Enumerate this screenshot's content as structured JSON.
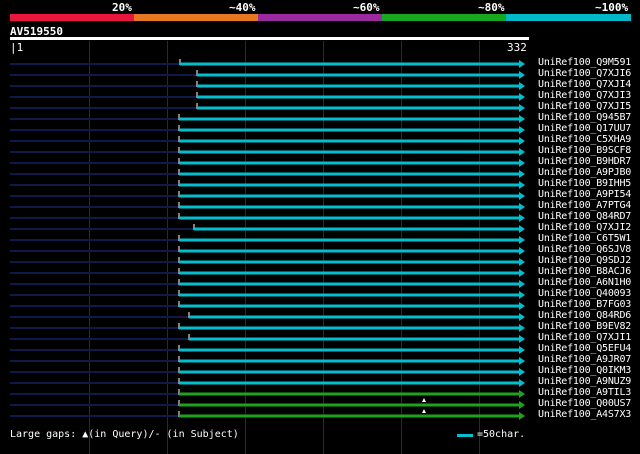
{
  "identity_scale": {
    "labels": [
      "20%",
      "~40%",
      "~60%",
      "~80%",
      "~100%"
    ],
    "colors": [
      "#e8163c",
      "#e87722",
      "#9b2aa0",
      "#18a81e",
      "#00b8c8"
    ]
  },
  "query": {
    "name": "AV519550",
    "start": "1",
    "end": "332"
  },
  "colors": {
    "aligned_cyan": "#00bfcf",
    "aligned_green": "#1fa31f",
    "unaligned_navy": "#101a4a",
    "gap_marker": "#ffffff"
  },
  "hits": [
    {
      "name": "UniRef100_Q9M591",
      "start_frac": 0.332,
      "color": "cyan"
    },
    {
      "name": "UniRef100_Q7XJI6",
      "start_frac": 0.365,
      "color": "cyan"
    },
    {
      "name": "UniRef100_Q7XJI4",
      "start_frac": 0.365,
      "color": "cyan"
    },
    {
      "name": "UniRef100_Q7XJI3",
      "start_frac": 0.365,
      "color": "cyan"
    },
    {
      "name": "UniRef100_Q7XJI5",
      "start_frac": 0.365,
      "color": "cyan"
    },
    {
      "name": "UniRef100_Q945B7",
      "start_frac": 0.33,
      "color": "cyan"
    },
    {
      "name": "UniRef100_Q17UU7",
      "start_frac": 0.33,
      "color": "cyan"
    },
    {
      "name": "UniRef100_C5XHA9",
      "start_frac": 0.33,
      "color": "cyan"
    },
    {
      "name": "UniRef100_B9SCF8",
      "start_frac": 0.33,
      "color": "cyan"
    },
    {
      "name": "UniRef100_B9HDR7",
      "start_frac": 0.33,
      "color": "cyan"
    },
    {
      "name": "UniRef100_A9PJB0",
      "start_frac": 0.33,
      "color": "cyan"
    },
    {
      "name": "UniRef100_B9IHH5",
      "start_frac": 0.33,
      "color": "cyan"
    },
    {
      "name": "UniRef100_A9PI54",
      "start_frac": 0.33,
      "color": "cyan"
    },
    {
      "name": "UniRef100_A7PTG4",
      "start_frac": 0.33,
      "color": "cyan"
    },
    {
      "name": "UniRef100_Q84RD7",
      "start_frac": 0.33,
      "color": "cyan"
    },
    {
      "name": "UniRef100_Q7XJI2",
      "start_frac": 0.358,
      "color": "cyan"
    },
    {
      "name": "UniRef100_C6T5W1",
      "start_frac": 0.33,
      "color": "cyan"
    },
    {
      "name": "UniRef100_Q6SJV8",
      "start_frac": 0.33,
      "color": "cyan"
    },
    {
      "name": "UniRef100_Q9SDJ2",
      "start_frac": 0.33,
      "color": "cyan"
    },
    {
      "name": "UniRef100_B8ACJ6",
      "start_frac": 0.33,
      "color": "cyan"
    },
    {
      "name": "UniRef100_A6N1H0",
      "start_frac": 0.33,
      "color": "cyan"
    },
    {
      "name": "UniRef100_Q40093",
      "start_frac": 0.33,
      "color": "cyan"
    },
    {
      "name": "UniRef100_B7FG03",
      "start_frac": 0.33,
      "color": "cyan"
    },
    {
      "name": "UniRef100_Q84RD6",
      "start_frac": 0.348,
      "color": "cyan"
    },
    {
      "name": "UniRef100_B9EV82",
      "start_frac": 0.33,
      "color": "cyan"
    },
    {
      "name": "UniRef100_Q7XJI1",
      "start_frac": 0.348,
      "color": "cyan"
    },
    {
      "name": "UniRef100_Q5EFU4",
      "start_frac": 0.33,
      "color": "cyan"
    },
    {
      "name": "UniRef100_A9JR07",
      "start_frac": 0.33,
      "color": "cyan"
    },
    {
      "name": "UniRef100_Q0IKM3",
      "start_frac": 0.33,
      "color": "cyan"
    },
    {
      "name": "UniRef100_A9NUZ9",
      "start_frac": 0.33,
      "color": "cyan"
    },
    {
      "name": "UniRef100_A9TIL3",
      "start_frac": 0.33,
      "color": "green"
    },
    {
      "name": "UniRef100_Q00US7",
      "start_frac": 0.33,
      "color": "green"
    },
    {
      "name": "UniRef100_A4S7X3",
      "start_frac": 0.33,
      "color": "green"
    }
  ],
  "footer": {
    "legend": "Large gaps: ▲(in Query)/- (in Subject)",
    "scale_label": "=50char."
  }
}
